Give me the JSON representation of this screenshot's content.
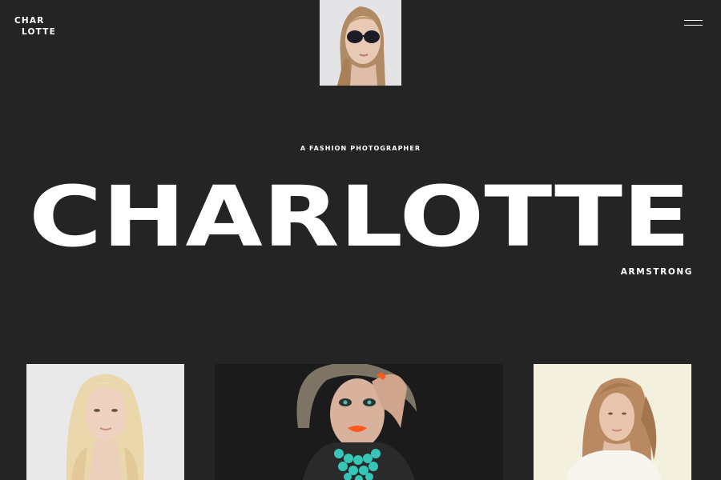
{
  "header": {
    "logo_line1": "CHAR",
    "logo_line2": "LOTTE",
    "menu_icon": "hamburger-icon"
  },
  "hero": {
    "tagline": "A FASHION PHOTOGRAPHER",
    "first_name": "CHARLOTTE",
    "last_name": "ARMSTRONG"
  },
  "colors": {
    "background": "#242424",
    "text": "#ffffff"
  }
}
